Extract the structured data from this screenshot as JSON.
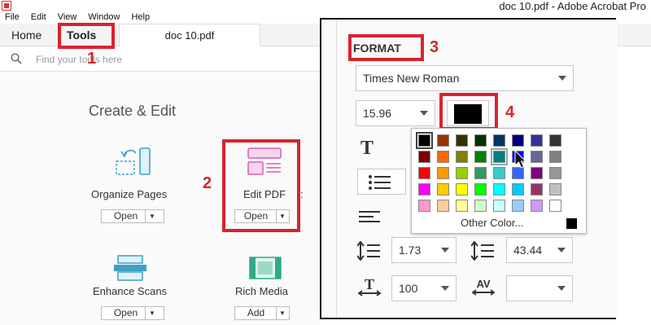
{
  "window": {
    "title": "doc 10.pdf - Adobe Acrobat Pro"
  },
  "menu": [
    "File",
    "Edit",
    "View",
    "Window",
    "Help"
  ],
  "tabs": {
    "home": "Home",
    "tools": "Tools",
    "doc": "doc 10.pdf"
  },
  "search": {
    "placeholder": "Find your tools here"
  },
  "section": {
    "title": "Create & Edit"
  },
  "tools": {
    "organize": {
      "label": "Organize Pages",
      "button": "Open"
    },
    "edit": {
      "label": "Edit PDF",
      "button": "Open"
    },
    "enhance": {
      "label": "Enhance Scans",
      "button": "Open"
    },
    "rich": {
      "label": "Rich Media",
      "button": "Add"
    }
  },
  "annotations": {
    "n1": "1",
    "n2": "2",
    "n3": "3",
    "n4": "4"
  },
  "format": {
    "title": "FORMAT",
    "font_family": "Times New Roman",
    "font_size": "15.96",
    "line_spacing": "1.73",
    "paragraph_spacing": "43.44",
    "horizontal_scale": "100",
    "char_spacing": "",
    "text_color": "#000000",
    "other_color_label": "Other Color..."
  },
  "palette": {
    "rows": [
      [
        "#000000",
        "#993300",
        "#333300",
        "#003300",
        "#003366",
        "#000080",
        "#333399",
        "#333333"
      ],
      [
        "#800000",
        "#ff6600",
        "#808000",
        "#008000",
        "#008080",
        "#0000ff",
        "#666699",
        "#808080"
      ],
      [
        "#ff0000",
        "#ff9900",
        "#99cc00",
        "#339966",
        "#33cccc",
        "#3366ff",
        "#800080",
        "#969696"
      ],
      [
        "#ff00ff",
        "#ffcc00",
        "#ffff00",
        "#00ff00",
        "#00ffff",
        "#00ccff",
        "#993366",
        "#c0c0c0"
      ],
      [
        "#ff99cc",
        "#ffcc99",
        "#ffff99",
        "#ccffcc",
        "#ccffff",
        "#99ccff",
        "#cc99ff",
        "#ffffff"
      ]
    ],
    "selected": [
      0,
      0
    ],
    "hovered": [
      1,
      4
    ]
  },
  "colors": {
    "accent": "#d9232e",
    "tool_icon": "#3ea0c7",
    "edit_icon": "#d65db1"
  }
}
